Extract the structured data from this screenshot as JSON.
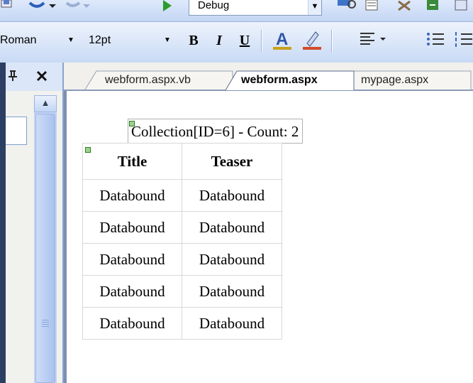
{
  "toolbar": {
    "configuration": "Debug"
  },
  "format_toolbar": {
    "font_name": "Roman",
    "font_size": "12pt",
    "bold": "B",
    "italic": "I",
    "underline": "U"
  },
  "tabs": [
    {
      "label": "webform.aspx.vb",
      "active": false
    },
    {
      "label": "webform.aspx",
      "active": true
    },
    {
      "label": "mypage.aspx",
      "active": false
    }
  ],
  "designer": {
    "collection_label": "Collection[ID=6] - Count: 2",
    "grid": {
      "headers": [
        "Title",
        "Teaser"
      ],
      "rows": [
        [
          "Databound",
          "Databound"
        ],
        [
          "Databound",
          "Databound"
        ],
        [
          "Databound",
          "Databound"
        ],
        [
          "Databound",
          "Databound"
        ],
        [
          "Databound",
          "Databound"
        ]
      ]
    }
  },
  "colors": {
    "toolbar_bg": "#c3d6f4",
    "control_glyph": "#9ed38d"
  }
}
